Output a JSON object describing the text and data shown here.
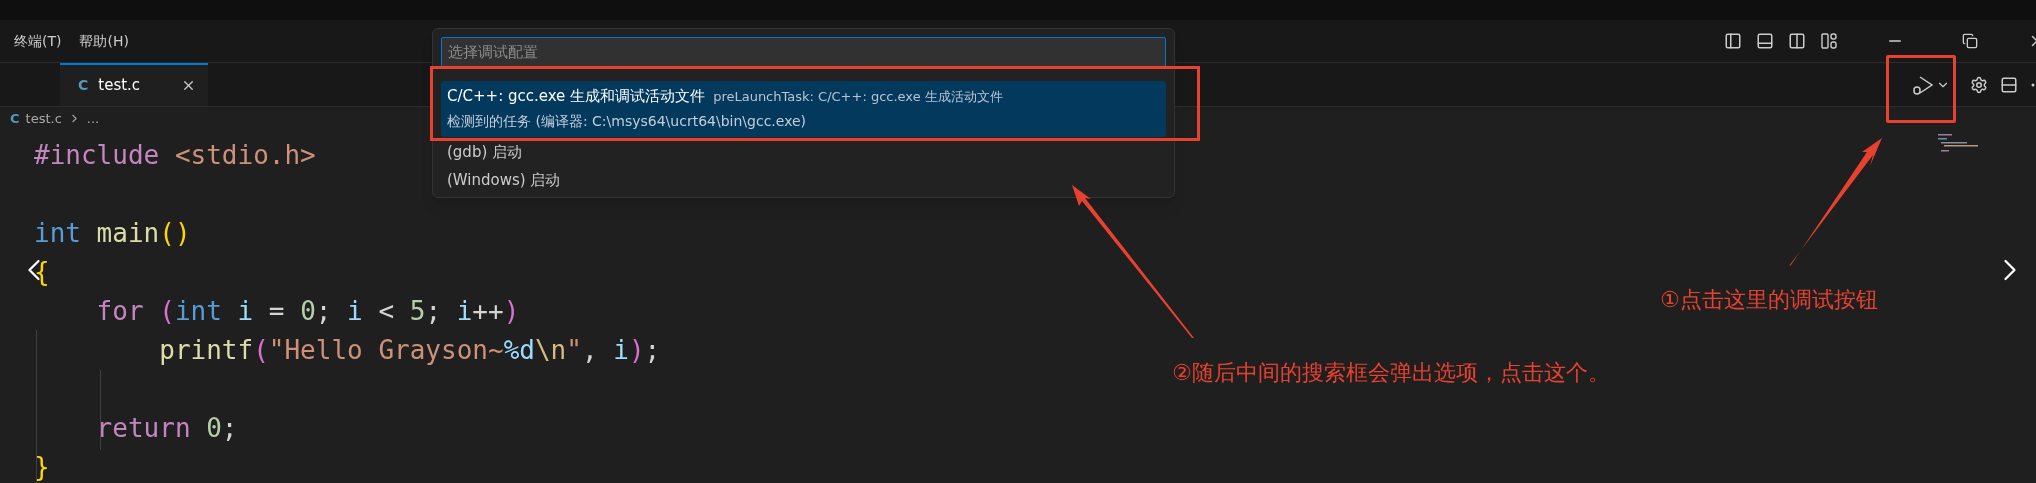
{
  "menu": [
    {
      "label": "终端(T)"
    },
    {
      "label": "帮助(H)"
    }
  ],
  "tabs": [
    {
      "icon": "C",
      "label": "test.c",
      "selected": true
    }
  ],
  "breadcrumb": [
    {
      "icon": "C",
      "label": "test.c"
    },
    {
      "label": "..."
    }
  ],
  "code": [
    {
      "kind": "code",
      "tokens": [
        {
          "text": "#include",
          "kind": "preproc"
        },
        {
          "text": " <stdio.h>",
          "kind": "string"
        }
      ]
    },
    {
      "kind": "blank"
    },
    {
      "kind": "code",
      "tokens": [
        {
          "text": "int",
          "kind": "type"
        },
        {
          "text": " main",
          "kind": "func"
        },
        {
          "text": "()",
          "kind": "bracket1"
        }
      ]
    },
    {
      "kind": "code",
      "tokens": [
        {
          "text": "{",
          "kind": "bracket1"
        }
      ]
    },
    {
      "kind": "code",
      "tokens": [
        {
          "text": "    for",
          "kind": "control"
        },
        {
          "text": " (",
          "kind": "bracket2"
        },
        {
          "text": "int",
          "kind": "type"
        },
        {
          "text": " i",
          "kind": "var"
        },
        {
          "text": " = ",
          "kind": "plain"
        },
        {
          "text": "0",
          "kind": "number"
        },
        {
          "text": "; ",
          "kind": "plain"
        },
        {
          "text": "i",
          "kind": "var"
        },
        {
          "text": " < ",
          "kind": "plain"
        },
        {
          "text": "5",
          "kind": "number"
        },
        {
          "text": "; ",
          "kind": "plain"
        },
        {
          "text": "i",
          "kind": "var"
        },
        {
          "text": "++",
          "kind": "plain"
        },
        {
          "text": ")",
          "kind": "bracket2"
        }
      ]
    },
    {
      "kind": "code",
      "tokens": [
        {
          "text": "        printf",
          "kind": "func"
        },
        {
          "text": "(",
          "kind": "bracket2"
        },
        {
          "text": "\"Hello Grayson~",
          "kind": "string"
        },
        {
          "text": "%d",
          "kind": "var"
        },
        {
          "text": "\\n",
          "kind": "escape"
        },
        {
          "text": "\"",
          "kind": "string"
        },
        {
          "text": ", ",
          "kind": "plain"
        },
        {
          "text": "i",
          "kind": "var"
        },
        {
          "text": ")",
          "kind": "bracket2"
        },
        {
          "text": ";",
          "kind": "plain"
        }
      ]
    },
    {
      "kind": "blank"
    },
    {
      "kind": "code",
      "tokens": [
        {
          "text": "    return",
          "kind": "control"
        },
        {
          "text": " 0",
          "kind": "number"
        },
        {
          "text": ";",
          "kind": "plain"
        }
      ]
    },
    {
      "kind": "code",
      "tokens": [
        {
          "text": "}",
          "kind": "bracket1"
        }
      ]
    }
  ],
  "quick_pick": {
    "placeholder": "选择调试配置",
    "items": [
      {
        "label": "C/C++: gcc.exe 生成和调试活动文件",
        "description": "preLaunchTask: C/C++: gcc.exe 生成活动文件",
        "detail": "检测到的任务 (编译器: C:\\msys64\\ucrt64\\bin\\gcc.exe)",
        "selected": true
      },
      {
        "label": "(gdb) 启动",
        "selected": false
      },
      {
        "label": "(Windows) 启动",
        "selected": false
      }
    ]
  },
  "annotations": [
    {
      "text": "①点击这里的调试按钮"
    },
    {
      "text": "②随后中间的搜索框会弹出选项，点击这个。"
    }
  ]
}
